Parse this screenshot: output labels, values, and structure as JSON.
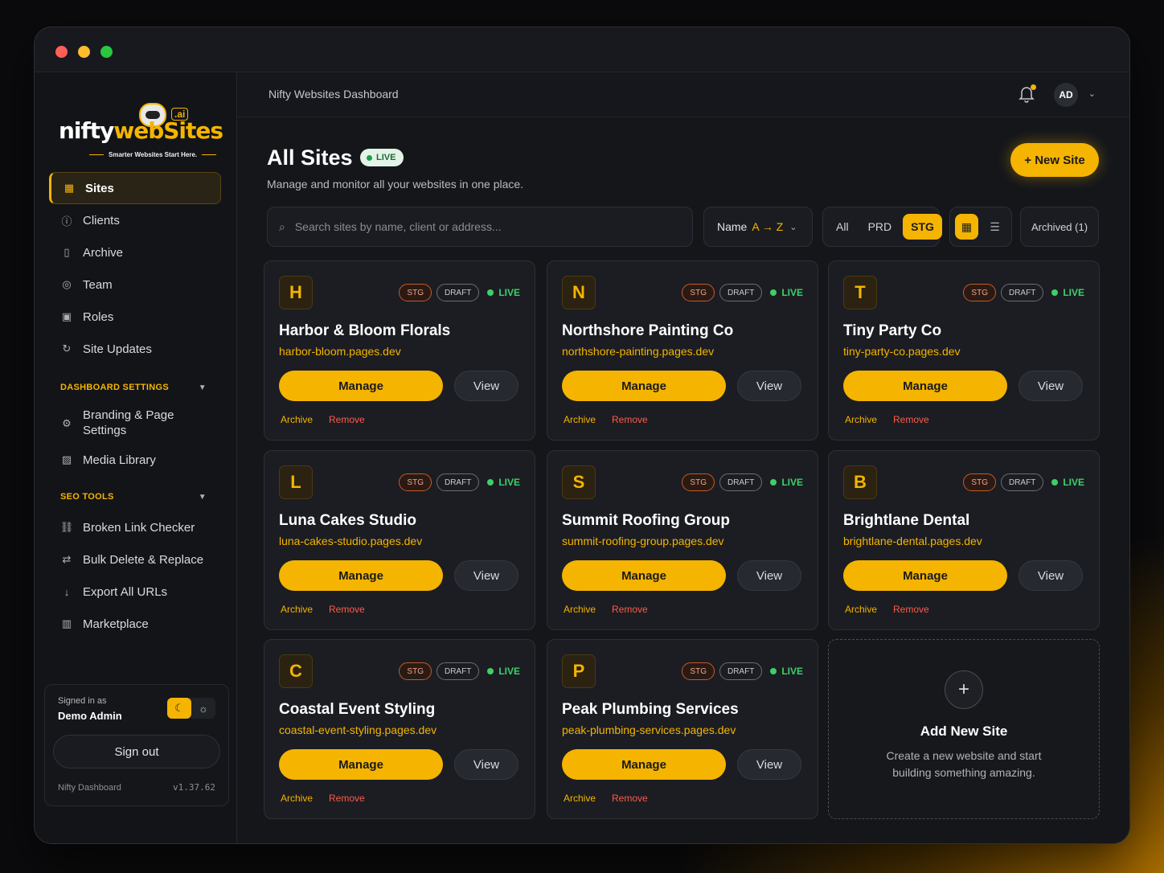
{
  "window": {
    "breadcrumb": "Nifty Websites Dashboard"
  },
  "brand": {
    "word_a": "nifty",
    "word_b": "web",
    "word_c": "Sites",
    "ai": ".ai",
    "tagline": "Smarter Websites Start Here."
  },
  "sidebar": {
    "items": [
      {
        "label": "Sites",
        "icon": "grid-icon"
      },
      {
        "label": "Clients",
        "icon": "info-icon"
      },
      {
        "label": "Archive",
        "icon": "archive-icon"
      },
      {
        "label": "Team",
        "icon": "team-icon"
      },
      {
        "label": "Roles",
        "icon": "roles-icon"
      },
      {
        "label": "Site Updates",
        "icon": "refresh-icon"
      }
    ],
    "settings_heading": "DASHBOARD SETTINGS",
    "settings_items": [
      {
        "label": "Branding & Page Settings",
        "icon": "gear-icon"
      },
      {
        "label": "Media Library",
        "icon": "image-icon"
      }
    ],
    "seo_heading": "SEO TOOLS",
    "seo_items": [
      {
        "label": "Broken Link Checker",
        "icon": "link-icon"
      },
      {
        "label": "Bulk Delete & Replace",
        "icon": "swap-icon"
      },
      {
        "label": "Export All URLs",
        "icon": "download-icon"
      },
      {
        "label": "Marketplace",
        "icon": "store-icon"
      }
    ],
    "user": {
      "signed_label": "Signed in as",
      "name": "Demo Admin",
      "sign_out": "Sign out",
      "app_name": "Nifty Dashboard",
      "version": "v1.37.62"
    }
  },
  "header": {
    "avatar": "AD"
  },
  "page": {
    "title": "All Sites",
    "live_badge": "LIVE",
    "subtitle": "Manage and monitor all your websites in one place.",
    "new_site": "+ New Site",
    "search_placeholder": "Search sites by name, client or address...",
    "sort_label": "Name",
    "sort_value": "A → Z",
    "env_filters": [
      "All",
      "PRD",
      "STG"
    ],
    "archived": "Archived (1)"
  },
  "sites": [
    {
      "letter": "H",
      "name": "Harbor & Bloom Florals",
      "url": "harbor-bloom.pages.dev"
    },
    {
      "letter": "N",
      "name": "Northshore Painting Co",
      "url": "northshore-painting.pages.dev"
    },
    {
      "letter": "T",
      "name": "Tiny Party Co",
      "url": "tiny-party-co.pages.dev"
    },
    {
      "letter": "L",
      "name": "Luna Cakes Studio",
      "url": "luna-cakes-studio.pages.dev"
    },
    {
      "letter": "S",
      "name": "Summit Roofing Group",
      "url": "summit-roofing-group.pages.dev"
    },
    {
      "letter": "B",
      "name": "Brightlane Dental",
      "url": "brightlane-dental.pages.dev"
    },
    {
      "letter": "C",
      "name": "Coastal Event Styling",
      "url": "coastal-event-styling.pages.dev"
    },
    {
      "letter": "P",
      "name": "Peak Plumbing Services",
      "url": "peak-plumbing-services.pages.dev"
    }
  ],
  "card_labels": {
    "stg": "STG",
    "draft": "DRAFT",
    "live": "LIVE",
    "manage": "Manage",
    "view": "View",
    "archive": "Archive",
    "remove": "Remove"
  },
  "add_card": {
    "title": "Add New Site",
    "description": "Create a new website and start building something amazing."
  },
  "colors": {
    "accent": "#f5b400",
    "live": "#3ecf6a",
    "remove": "#ff5a4a"
  }
}
